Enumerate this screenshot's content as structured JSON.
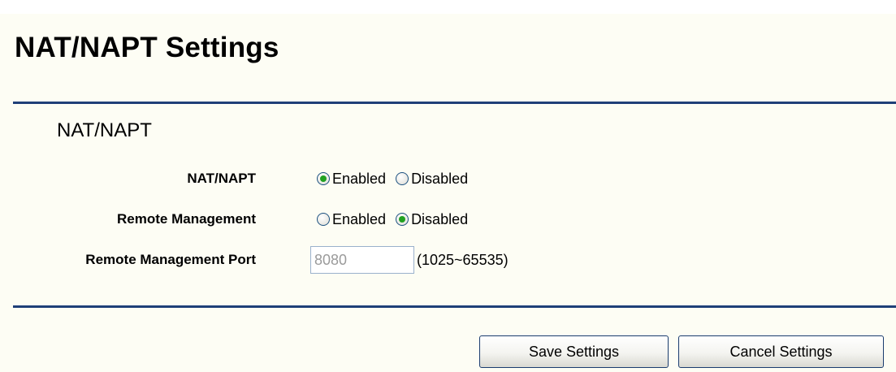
{
  "page": {
    "title": "NAT/NAPT Settings"
  },
  "section": {
    "title": "NAT/NAPT"
  },
  "form": {
    "nat_napt": {
      "label": "NAT/NAPT",
      "options": [
        "Enabled",
        "Disabled"
      ],
      "selected": "Enabled"
    },
    "remote_management": {
      "label": "Remote Management",
      "options": [
        "Enabled",
        "Disabled"
      ],
      "selected": "Disabled"
    },
    "remote_management_port": {
      "label": "Remote Management Port",
      "value": "8080",
      "range_hint": "(1025~65535)"
    }
  },
  "buttons": {
    "save_label": "Save Settings",
    "cancel_label": "Cancel Settings"
  },
  "colors": {
    "panel_background": "#fdfdf4",
    "rule": "#1f3f78",
    "radio_border": "#1c5180",
    "radio_selected": "#21a121",
    "input_text_disabled": "#9a9a9a"
  }
}
